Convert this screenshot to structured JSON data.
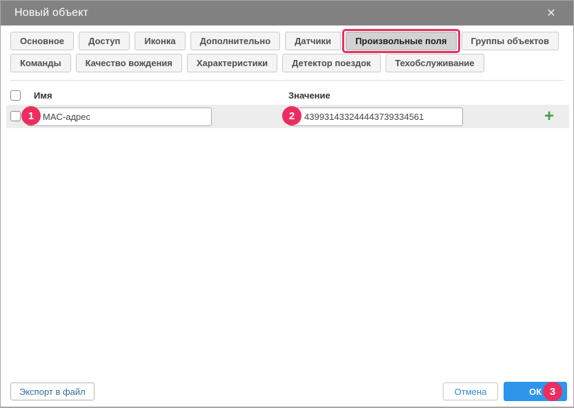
{
  "dialog": {
    "title": "Новый объект",
    "close_icon": "✕"
  },
  "tabs": {
    "row1": [
      {
        "label": "Основное"
      },
      {
        "label": "Доступ"
      },
      {
        "label": "Иконка"
      },
      {
        "label": "Дополнительно"
      },
      {
        "label": "Датчики"
      },
      {
        "label": "Произвольные поля",
        "active": true
      },
      {
        "label": "Группы объектов"
      }
    ],
    "row2": [
      {
        "label": "Команды"
      },
      {
        "label": "Качество вождения"
      },
      {
        "label": "Характеристики"
      },
      {
        "label": "Детектор поездок"
      },
      {
        "label": "Техобслуживание"
      }
    ]
  },
  "table": {
    "columns": {
      "name": "Имя",
      "value": "Значение"
    },
    "rows": [
      {
        "name": "MAC-адрес",
        "value": "439931433244443739334561",
        "checked": false
      }
    ],
    "add_icon": "+"
  },
  "annotations": {
    "badge1": "1",
    "badge2": "2",
    "badge3": "3",
    "color": "#ec2d60"
  },
  "footer": {
    "export_label": "Экспорт в файл",
    "cancel_label": "Отмена",
    "ok_label": "ОК"
  },
  "colors": {
    "titlebar": "#828282",
    "active_tab_bg": "#d2d2d2",
    "row_bg": "#ededed",
    "ok_button": "#2d96ea",
    "add_icon_green": "#43a047",
    "annotation": "#ec2d60"
  }
}
